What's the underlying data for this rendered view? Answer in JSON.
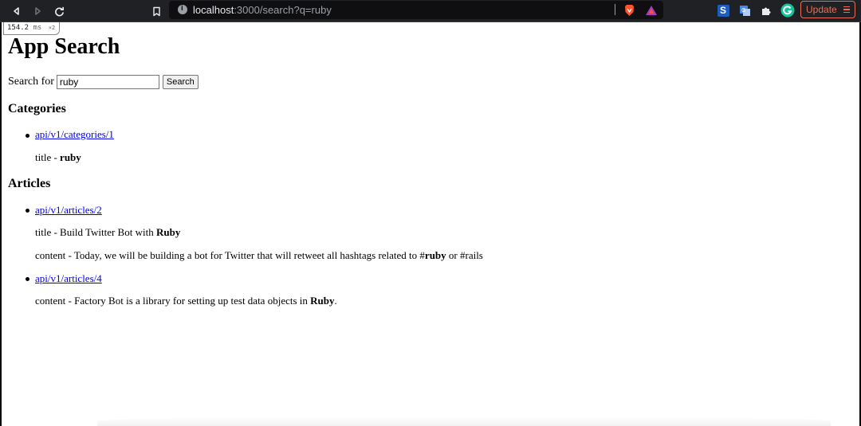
{
  "browser": {
    "url_host": "localhost",
    "url_rest": ":3000/search?q=ruby",
    "update_label": "Update"
  },
  "perf": {
    "time": "154.2",
    "unit": "ms",
    "multiplier": "×2"
  },
  "page": {
    "title": "App Search",
    "search_label": "Search for",
    "search_value": "ruby",
    "search_button": "Search"
  },
  "categories": {
    "heading": "Categories",
    "items": [
      {
        "link": "api/v1/categories/1",
        "title_prefix": "title - ",
        "title_value": "ruby"
      }
    ]
  },
  "articles": {
    "heading": "Articles",
    "items": [
      {
        "link": "api/v1/articles/2",
        "title_prefix": "title - Build Twitter Bot with ",
        "title_value": "Ruby",
        "content_prefix": "content - Today, we will be building a bot for Twitter that will retweet all hashtags related to #",
        "content_value": "ruby",
        "content_suffix": " or #rails"
      },
      {
        "link": "api/v1/articles/4",
        "content_prefix": "content - Factory Bot is a library for setting up test data objects in ",
        "content_value": "Ruby",
        "content_suffix": "."
      }
    ]
  },
  "colors": {
    "link": "#0000ee",
    "chrome_bg": "#202124",
    "update_accent": "#e8705a"
  }
}
